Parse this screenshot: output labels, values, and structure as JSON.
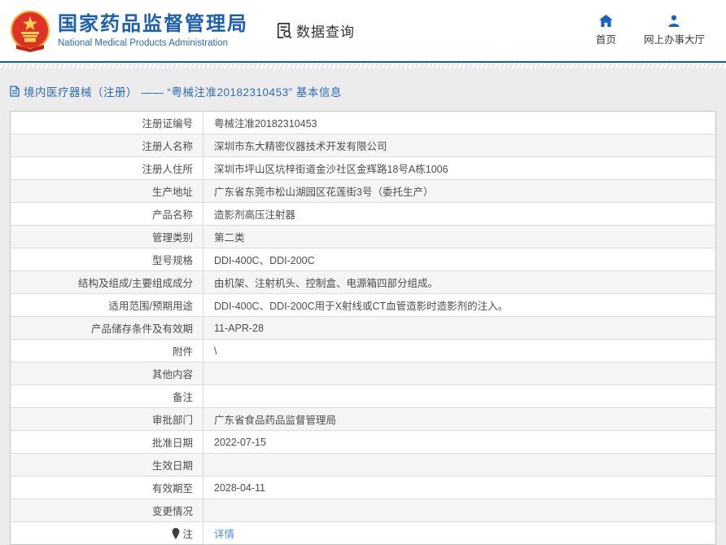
{
  "header": {
    "org_name_cn": "国家药品监督管理局",
    "org_name_en": "National Medical Products Administration",
    "data_query_label": "数据查询",
    "nav": {
      "home_label": "首页",
      "service_hall_label": "网上办事大厅"
    }
  },
  "breadcrumb": {
    "title": "境内医疗器械（注册） —— “粤械注准20182310453” 基本信息"
  },
  "colors": {
    "brand_blue": "#1c5fae",
    "icon_blue": "#1b61c0",
    "link_blue": "#4a90d9",
    "rule_blue": "#1660ab",
    "page_bg": "#ececec",
    "alt_row_bg": "#f5f5f5",
    "emblem_red": "#de3226",
    "emblem_gold": "#f7d358"
  },
  "table": {
    "rows": [
      {
        "label": "注册证编号",
        "value": "粤械注准20182310453"
      },
      {
        "label": "注册人名称",
        "value": "深圳市东大精密仪器技术开发有限公司"
      },
      {
        "label": "注册人住所",
        "value": "深圳市坪山区坑梓街道金沙社区金辉路18号A栋1006"
      },
      {
        "label": "生产地址",
        "value": "广东省东莞市松山湖园区花莲街3号（委托生产）"
      },
      {
        "label": "产品名称",
        "value": "造影剂高压注射器"
      },
      {
        "label": "管理类别",
        "value": "第二类"
      },
      {
        "label": "型号规格",
        "value": "DDI-400C、DDI-200C"
      },
      {
        "label": "结构及组成/主要组成成分",
        "value": "由机架、注射机头、控制盒、电源箱四部分组成。"
      },
      {
        "label": "适用范围/预期用途",
        "value": "DDI-400C、DDI-200C用于X射线或CT血管造影时造影剂的注入。"
      },
      {
        "label": "产品储存条件及有效期",
        "value": "11-APR-28"
      },
      {
        "label": "附件",
        "value": "\\"
      },
      {
        "label": "其他内容",
        "value": ""
      },
      {
        "label": "备注",
        "value": ""
      },
      {
        "label": "审批部门",
        "value": "广东省食品药品监督管理局"
      },
      {
        "label": "批准日期",
        "value": "2022-07-15"
      },
      {
        "label": "生效日期",
        "value": ""
      },
      {
        "label": "有效期至",
        "value": "2028-04-11"
      },
      {
        "label": "变更情况",
        "value": ""
      },
      {
        "label": "注",
        "value": "详情",
        "value_is_link": true,
        "label_icon": "pin-icon"
      }
    ]
  }
}
